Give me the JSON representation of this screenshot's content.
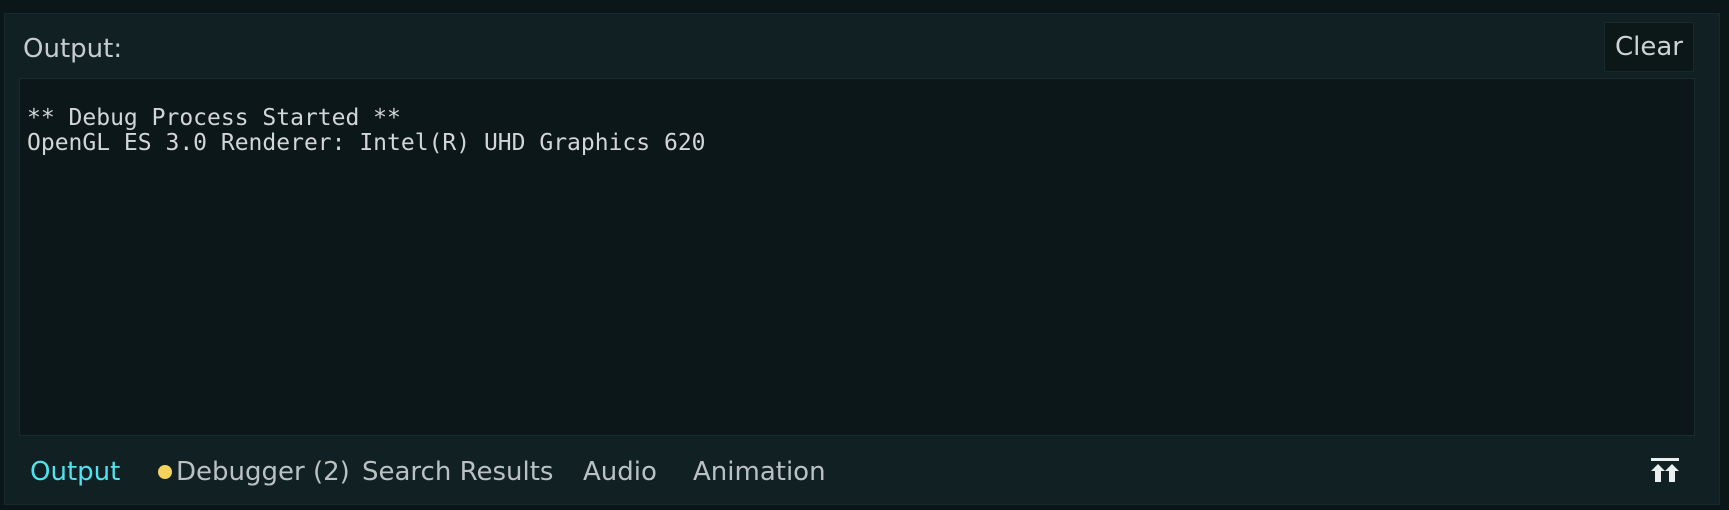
{
  "header": {
    "title": "Output:",
    "clear_label": "Clear"
  },
  "console": {
    "lines": [
      "** Debug Process Started **",
      "OpenGL ES 3.0 Renderer: Intel(R) UHD Graphics 620"
    ]
  },
  "tabs": [
    {
      "label": "Output",
      "active": true
    },
    {
      "label": "Debugger (2)",
      "indicator": "yellow-dot"
    },
    {
      "label": "Search Results"
    },
    {
      "label": "Audio"
    },
    {
      "label": "Animation"
    }
  ],
  "icons": {
    "expand": "expand-panel-icon",
    "debugger_indicator": "status-dot-icon"
  },
  "colors": {
    "active_tab": "#4fe3f2",
    "debugger_dot": "#f5d25c",
    "background": "#112022"
  }
}
